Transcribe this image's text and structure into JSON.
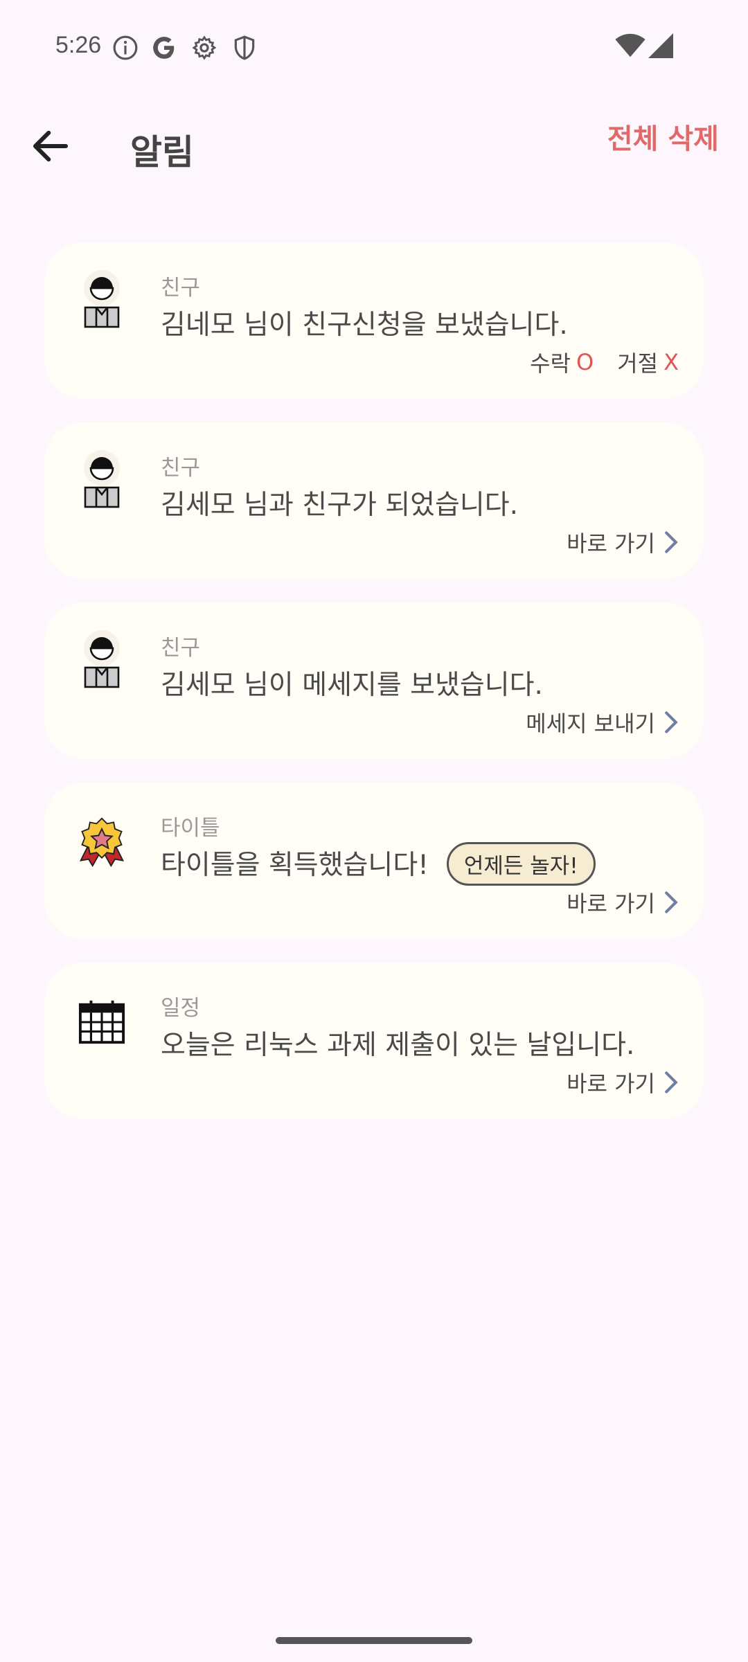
{
  "status_bar": {
    "time": "5:26",
    "icons": [
      "info-icon",
      "google-icon",
      "gear-icon",
      "shield-icon",
      "wifi-icon",
      "signal-icon"
    ]
  },
  "app_bar": {
    "back_icon": "arrow-left-icon",
    "title": "알림",
    "clear_all_label": "전체 삭제"
  },
  "colors": {
    "background": "#fdf6fd",
    "card": "#fffdf6",
    "accent_red": "#e06a6a",
    "chevron": "#6e7fa6"
  },
  "notifications": [
    {
      "icon": "user-avatar-icon",
      "category": "친구",
      "message": "김네모 님이 친구신청을 보냈습니다.",
      "accept_label": "수락",
      "accept_mark": "O",
      "reject_label": "거절",
      "reject_mark": "X"
    },
    {
      "icon": "user-avatar-icon",
      "category": "친구",
      "message": "김세모 님과 친구가 되었습니다.",
      "action_label": "바로 가기"
    },
    {
      "icon": "user-avatar-icon",
      "category": "친구",
      "message": "김세모 님이 메세지를 보냈습니다.",
      "action_label": "메세지 보내기"
    },
    {
      "icon": "medal-badge-icon",
      "category": "타이틀",
      "message": "타이틀을 획득했습니다!",
      "badge": "언제든 놀자!",
      "action_label": "바로 가기"
    },
    {
      "icon": "calendar-icon",
      "category": "일정",
      "message": "오늘은 리눅스 과제 제출이 있는 날입니다.",
      "action_label": "바로 가기"
    }
  ]
}
